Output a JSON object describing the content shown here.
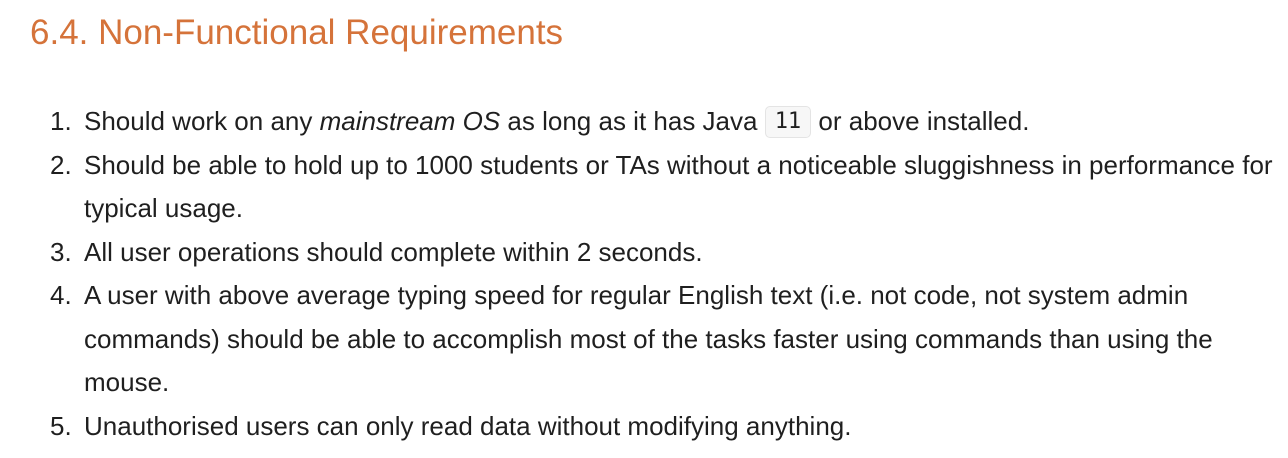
{
  "section": {
    "heading": "6.4. Non-Functional Requirements"
  },
  "requirements": [
    {
      "number": "1.",
      "part_before": "Should work on any ",
      "emphasis": "mainstream OS",
      "part_middle": " as long as it has Java ",
      "code": "11",
      "part_after": " or above installed."
    },
    {
      "number": "2.",
      "text": "Should be able to hold up to 1000 students or TAs without a noticeable sluggishness in performance for typical usage."
    },
    {
      "number": "3.",
      "text": "All user operations should complete within 2 seconds."
    },
    {
      "number": "4.",
      "text": "A user with above average typing speed for regular English text (i.e. not code, not system admin commands) should be able to accomplish most of the tasks faster using commands than using the mouse."
    },
    {
      "number": "5.",
      "text": "Unauthorised users can only read data without modifying anything."
    }
  ],
  "colors": {
    "heading": "#d5733a",
    "body_text": "#1f1f1f",
    "code_background": "#f7f7f7",
    "code_border": "#e4e4e4"
  }
}
